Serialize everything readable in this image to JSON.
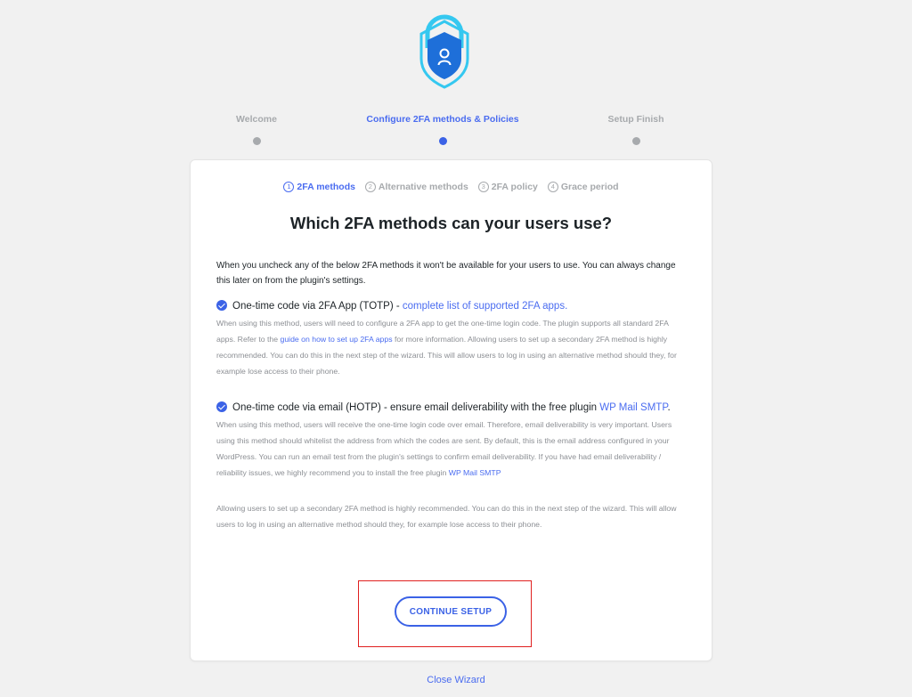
{
  "wizard": {
    "steps": [
      {
        "label": "Welcome",
        "active": false
      },
      {
        "label": "Configure 2FA methods & Policies",
        "active": true
      },
      {
        "label": "Setup Finish",
        "active": false
      }
    ],
    "substeps": [
      {
        "num": "1",
        "label": "2FA methods",
        "active": true
      },
      {
        "num": "2",
        "label": "Alternative methods",
        "active": false
      },
      {
        "num": "3",
        "label": "2FA policy",
        "active": false
      },
      {
        "num": "4",
        "label": "Grace period",
        "active": false
      }
    ],
    "title": "Which 2FA methods can your users use?",
    "intro": "When you uncheck any of the below 2FA methods it won't be available for your users to use. You can always change this later on from the plugin's settings.",
    "totp": {
      "label": "One-time code via 2FA App (TOTP) - ",
      "link": "complete list of supported 2FA apps.",
      "desc_before": "When using this method, users will need to configure a 2FA app to get the one-time login code. The plugin supports all standard 2FA apps. Refer to the ",
      "desc_link": "guide on how to set up 2FA apps",
      "desc_after": " for more information. Allowing users to set up a secondary 2FA method is highly recommended. You can do this in the next step of the wizard. This will allow users to log in using an alternative method should they, for example lose access to their phone."
    },
    "hotp": {
      "label": "One-time code via email (HOTP) - ensure email deliverability with the free plugin ",
      "link": "WP Mail SMTP",
      "label_end": ".",
      "desc_before": "When using this method, users will receive the one-time login code over email. Therefore, email deliverability is very important. Users using this method should whitelist the address from which the codes are sent. By default, this is the email address configured in your WordPress. You can run an email test from the plugin's settings to confirm email deliverability. If you have had email deliverability / reliability issues, we highly recommend you to install the free plugin ",
      "desc_link": "WP Mail SMTP"
    },
    "note": "Allowing users to set up a secondary 2FA method is highly recommended. You can do this in the next step of the wizard. This will allow users to log in using an alternative method should they, for example lose access to their phone.",
    "continue_label": "CONTINUE SETUP",
    "close_label": "Close Wizard"
  },
  "colors": {
    "accent": "#3b62e6",
    "inactive": "#a7aaad",
    "highlight": "#e0201f",
    "logo_blue": "#1e6fd9",
    "logo_cyan": "#35c8f0"
  },
  "icons": {
    "logo": "shield-lock-icon",
    "check": "checkmark-circle-icon"
  }
}
